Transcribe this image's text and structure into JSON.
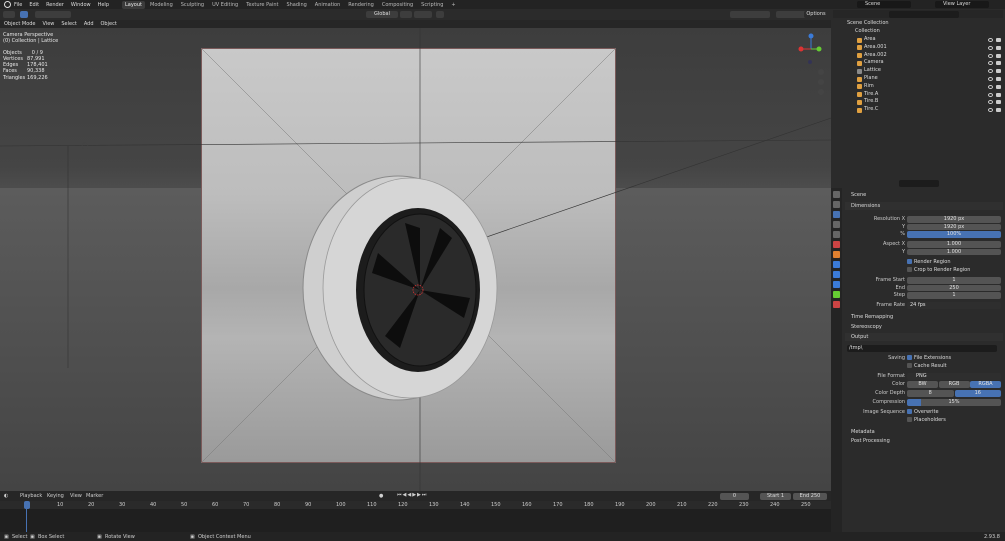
{
  "menu": {
    "items": [
      "File",
      "Edit",
      "Render",
      "Window",
      "Help"
    ]
  },
  "workspaces": [
    {
      "label": "Layout",
      "active": true
    },
    {
      "label": "Modeling",
      "active": false
    },
    {
      "label": "Sculpting",
      "active": false
    },
    {
      "label": "UV Editing",
      "active": false
    },
    {
      "label": "Texture Paint",
      "active": false
    },
    {
      "label": "Shading",
      "active": false
    },
    {
      "label": "Animation",
      "active": false
    },
    {
      "label": "Rendering",
      "active": false
    },
    {
      "label": "Compositing",
      "active": false
    },
    {
      "label": "Scripting",
      "active": false
    }
  ],
  "scene_name": "Scene",
  "view_layer": "View Layer",
  "viewport_header": {
    "mode": "Object Mode",
    "view": "View",
    "select": "Select",
    "add": "Add",
    "object": "Object",
    "transform": "Global",
    "options": "Options"
  },
  "stats": {
    "title": "Camera Perspective",
    "collection": "(0) Collection | Lattice",
    "rows": [
      {
        "k": "Objects",
        "v": "0 / 9"
      },
      {
        "k": "Vertices",
        "v": "87,991"
      },
      {
        "k": "Edges",
        "v": "178,401"
      },
      {
        "k": "Faces",
        "v": "90,338"
      },
      {
        "k": "Triangles",
        "v": "169,226"
      }
    ]
  },
  "outliner": {
    "root": "Scene Collection",
    "collection": "Collection",
    "items": [
      {
        "label": "Area",
        "color": "#e0a040"
      },
      {
        "label": "Area.001",
        "color": "#e0a040"
      },
      {
        "label": "Area.002",
        "color": "#e0a040"
      },
      {
        "label": "Camera",
        "color": "#e0a040"
      },
      {
        "label": "Lattice",
        "color": "#8a8a8a"
      },
      {
        "label": "Plane",
        "color": "#e0a040"
      },
      {
        "label": "Rim",
        "color": "#e0a040"
      },
      {
        "label": "Tire.A",
        "color": "#e0a040"
      },
      {
        "label": "Tire.B",
        "color": "#e0a040"
      },
      {
        "label": "Tire.C",
        "color": "#e0a040"
      }
    ]
  },
  "properties": {
    "context": "Scene",
    "dimensions": "Dimensions",
    "resolution_x_label": "Resolution X",
    "resolution_x": "1920 px",
    "y_label": "Y",
    "resolution_y": "1920 px",
    "percent_label": "%",
    "percent": "100%",
    "aspect_x_label": "Aspect X",
    "aspect_x": "1.000",
    "aspect_y_label": "Y",
    "aspect_y": "1.000",
    "render_region": "Render Region",
    "crop": "Crop to Render Region",
    "frame_start_label": "Frame Start",
    "frame_start": "1",
    "end_label": "End",
    "frame_end": "250",
    "step_label": "Step",
    "step": "1",
    "frame_rate_label": "Frame Rate",
    "frame_rate": "24 fps",
    "time_remapping": "Time Remapping",
    "stereoscopy": "Stereoscopy",
    "output": "Output",
    "output_path": "/tmp\\",
    "saving_label": "Saving",
    "file_ext": "File Extensions",
    "cache_result": "Cache Result",
    "file_format_label": "File Format",
    "file_format": "PNG",
    "color_label": "Color",
    "color_bw": "BW",
    "color_rgb": "RGB",
    "color_rgba": "RGBA",
    "depth_label": "Color Depth",
    "depth_8": "8",
    "depth_16": "16",
    "compression_label": "Compression",
    "compression": "15%",
    "image_seq_label": "Image Sequence",
    "overwrite": "Overwrite",
    "placeholders": "Placeholders",
    "metadata": "Metadata",
    "post_processing": "Post Processing"
  },
  "timeline": {
    "playback": "Playback",
    "keying": "Keying",
    "view": "View",
    "marker": "Marker",
    "current_frame": "0",
    "start_label": "Start",
    "start": "1",
    "end_label": "End",
    "end": "250",
    "ticks": [
      "0",
      "10",
      "20",
      "30",
      "40",
      "50",
      "60",
      "70",
      "80",
      "90",
      "100",
      "110",
      "120",
      "130",
      "140",
      "150",
      "160",
      "170",
      "180",
      "190",
      "200",
      "210",
      "220",
      "230",
      "240",
      "250"
    ]
  },
  "status": {
    "select": "Select",
    "box": "Box Select",
    "rotate": "Rotate View",
    "context": "Object Context Menu",
    "version": "2.93.8"
  },
  "colors": {
    "accent": "#4772b3",
    "active_tab": "#3b3b3b",
    "object_icon": "#e0a040"
  }
}
